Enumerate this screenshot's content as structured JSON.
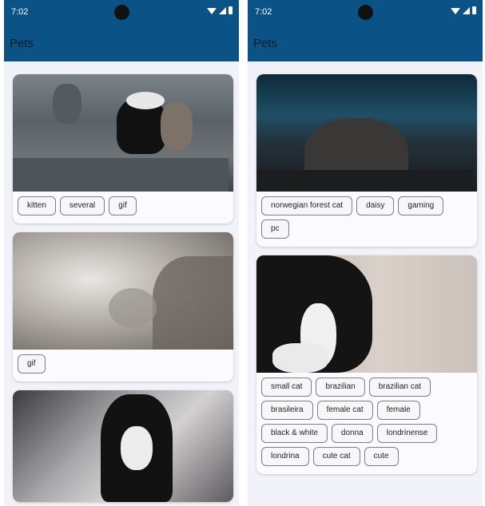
{
  "status_bar": {
    "time": "7:02"
  },
  "app_bar": {
    "title": "Pets"
  },
  "left_feed": [
    {
      "tags": [
        "kitten",
        "several",
        "gif"
      ]
    },
    {
      "tags": [
        "gif"
      ]
    },
    {
      "tags": []
    }
  ],
  "right_feed": [
    {
      "tags": [
        "norwegian forest cat",
        "daisy",
        "gaming",
        "pc"
      ]
    },
    {
      "tags": [
        "small cat",
        "brazilian",
        "brazilian cat",
        "brasileira",
        "female cat",
        "female",
        "black & white",
        "donna",
        "londrinense",
        "londrina",
        "cute cat",
        "cute"
      ]
    }
  ],
  "colors": {
    "app_bar": "#0b5286",
    "background": "#f1f3f8",
    "chip_border": "#7d7d86"
  }
}
